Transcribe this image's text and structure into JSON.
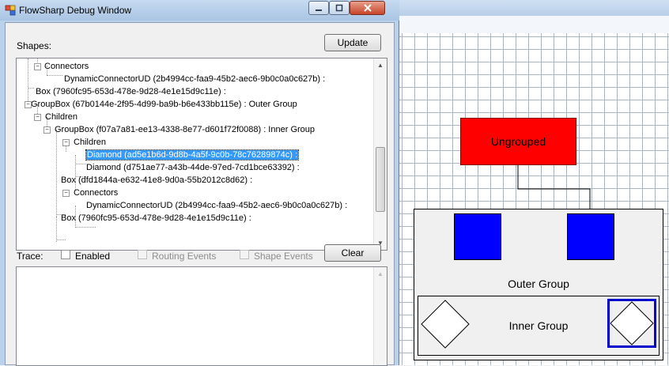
{
  "debug_window": {
    "title": "FlowSharp Debug Window",
    "shapes_label": "Shapes:",
    "update_label": "Update",
    "trace_label": "Trace:",
    "enabled_label": "Enabled",
    "routing_events_label": "Routing Events",
    "shape_events_label": "Shape Events",
    "clear_label": "Clear"
  },
  "tree": {
    "rows": [
      {
        "text": "Connectors",
        "expander": "-"
      },
      {
        "text": "DynamicConnectorUD (2b4994cc-faa9-45b2-aec6-9b0c0a0c627b) :",
        "expander": ""
      },
      {
        "text": "Box (7960fc95-653d-478e-9d28-4e1e15d9c11e) :",
        "expander": ""
      },
      {
        "text": "GroupBox (67b0144e-2f95-4d99-ba9b-b6e433bb115e) : Outer Group",
        "expander": "-"
      },
      {
        "text": "Children",
        "expander": "-"
      },
      {
        "text": "GroupBox (f07a7a81-ee13-4338-8e77-d601f72f0088) : Inner Group",
        "expander": "-"
      },
      {
        "text": "Children",
        "expander": "-"
      },
      {
        "text": "Diamond (ad5e1b6d-9d8b-4a5f-9c0b-78c76289874c) :",
        "expander": "",
        "selected": true
      },
      {
        "text": "Diamond (d751ae77-a43b-44de-97ed-7cd1bce63392) :",
        "expander": ""
      },
      {
        "text": "Box (dfd1844a-e632-41e8-9d0a-55b2012c8d62) :",
        "expander": ""
      },
      {
        "text": "Connectors",
        "expander": "-"
      },
      {
        "text": "DynamicConnectorUD (2b4994cc-faa9-45b2-aec6-9b0c0a0c627b) :",
        "expander": ""
      },
      {
        "text": "Box (7960fc95-653d-478e-9d28-4e1e15d9c11e) :",
        "expander": ""
      }
    ]
  },
  "canvas": {
    "ungrouped_label": "Ungrouped",
    "outer_group_label": "Outer Group",
    "inner_group_label": "Inner Group",
    "colors": {
      "red": "#ff0000",
      "blue": "#0000ff",
      "grid": "#aab6c6"
    }
  },
  "icons": {
    "app": "flowsharp-app-icon",
    "minimize": "minimize-icon",
    "maximize": "maximize-icon",
    "close": "close-icon"
  }
}
